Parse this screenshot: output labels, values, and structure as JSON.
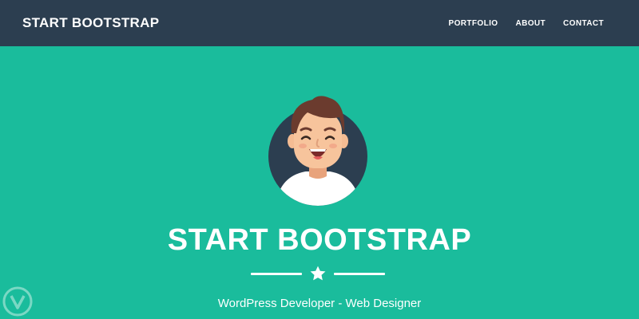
{
  "navbar": {
    "brand": "START BOOTSTRAP",
    "links": [
      {
        "label": "PORTFOLIO"
      },
      {
        "label": "ABOUT"
      },
      {
        "label": "CONTACT"
      }
    ]
  },
  "masthead": {
    "heading": "START BOOTSTRAP",
    "subheading": "WordPress Developer - Web Designer",
    "avatar_icon": "avatar-face-icon",
    "divider_icon": "star-icon"
  },
  "colors": {
    "navbar_bg": "#2c3e50",
    "masthead_bg": "#1abc9c",
    "text": "#ffffff"
  }
}
